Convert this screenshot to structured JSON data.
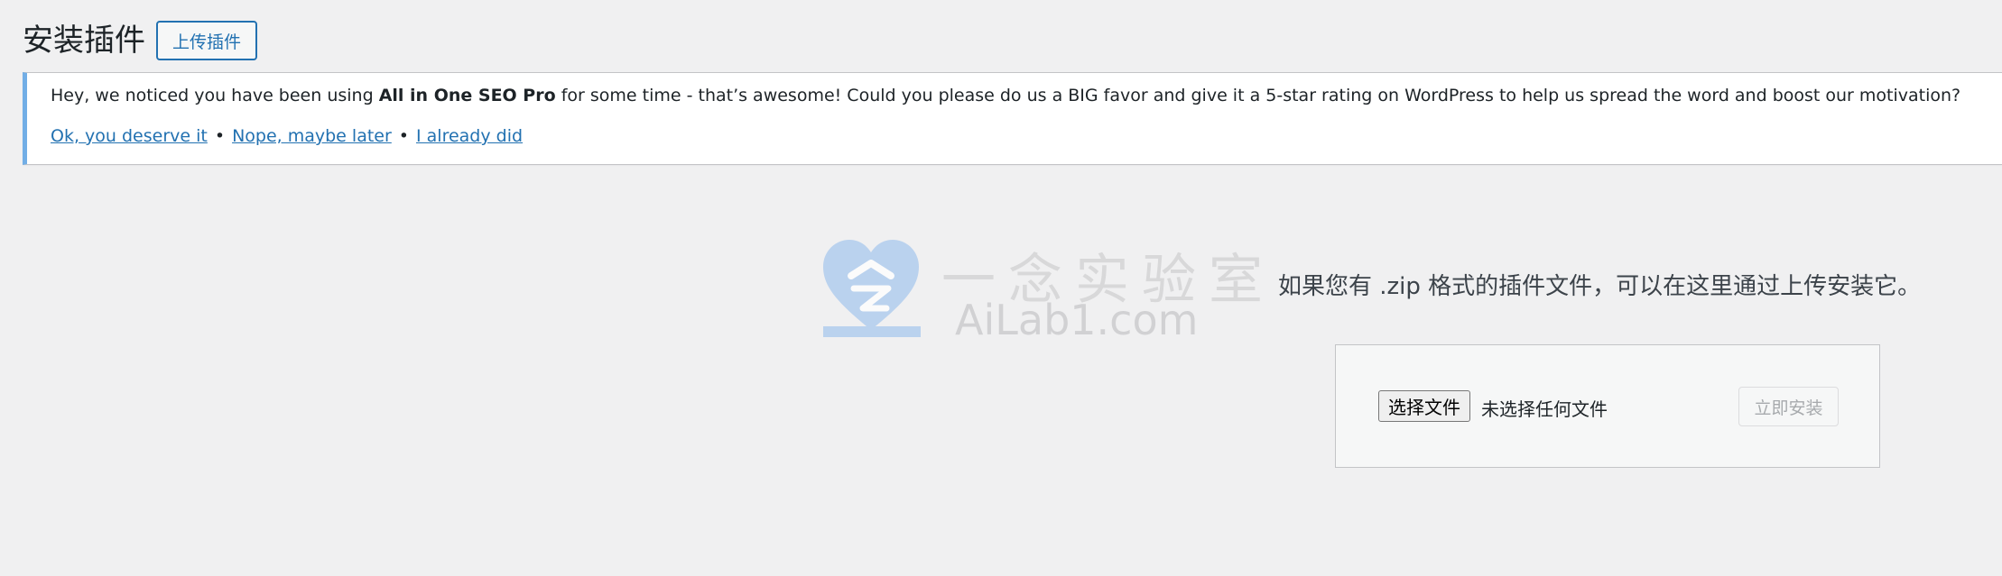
{
  "header": {
    "title": "安装插件",
    "upload_button": "上传插件"
  },
  "notice": {
    "message_prefix": "Hey, we noticed you have been using ",
    "plugin_name": "All in One SEO Pro",
    "message_suffix": " for some time - that’s awesome! Could you please do us a BIG favor and give it a 5-star rating on WordPress to help us spread the word and boost our motivation?",
    "links": {
      "deserve": "Ok, you deserve it",
      "later": "Nope, maybe later",
      "already": "I already did"
    },
    "separator": "•",
    "accent_color": "#72aee6"
  },
  "watermark": {
    "text_cn": "一念实验室",
    "text_en": "AiLab1.com",
    "logo_color": "#a8c8ee"
  },
  "upload": {
    "description": "如果您有 .zip 格式的插件文件，可以在这里通过上传安装它。",
    "choose_file": "选择文件",
    "no_file": "未选择任何文件",
    "install_now": "立即安装"
  },
  "colors": {
    "link": "#2271b1",
    "background": "#f0f0f1"
  }
}
